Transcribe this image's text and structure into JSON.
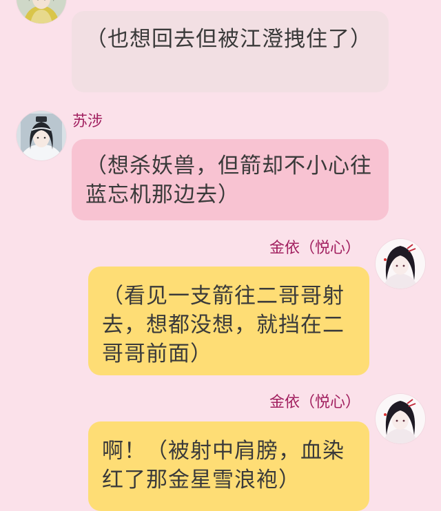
{
  "colors": {
    "background": "#fbe1ea",
    "sender_name": "#a11f5f",
    "bubble_grey": "#f2dfe3",
    "bubble_pink": "#f8c3d2",
    "bubble_yellow": "#fedd75"
  },
  "messages": [
    {
      "side": "left",
      "avatar": "avatar-icon",
      "text": "（也想回去但被江澄拽住了）"
    },
    {
      "side": "left",
      "sender": "苏涉",
      "avatar": "avatar-icon",
      "text": "（想杀妖兽，但箭却不小心往蓝忘机那边去）"
    },
    {
      "side": "right",
      "sender": "金依（悦心）",
      "avatar": "avatar-icon",
      "text": "（看见一支箭往二哥哥射去，想都没想，就挡在二哥哥前面）"
    },
    {
      "side": "right",
      "sender": "金依（悦心）",
      "avatar": "avatar-icon",
      "text": "啊！（被射中肩膀，血染红了那金星雪浪袍）"
    }
  ]
}
